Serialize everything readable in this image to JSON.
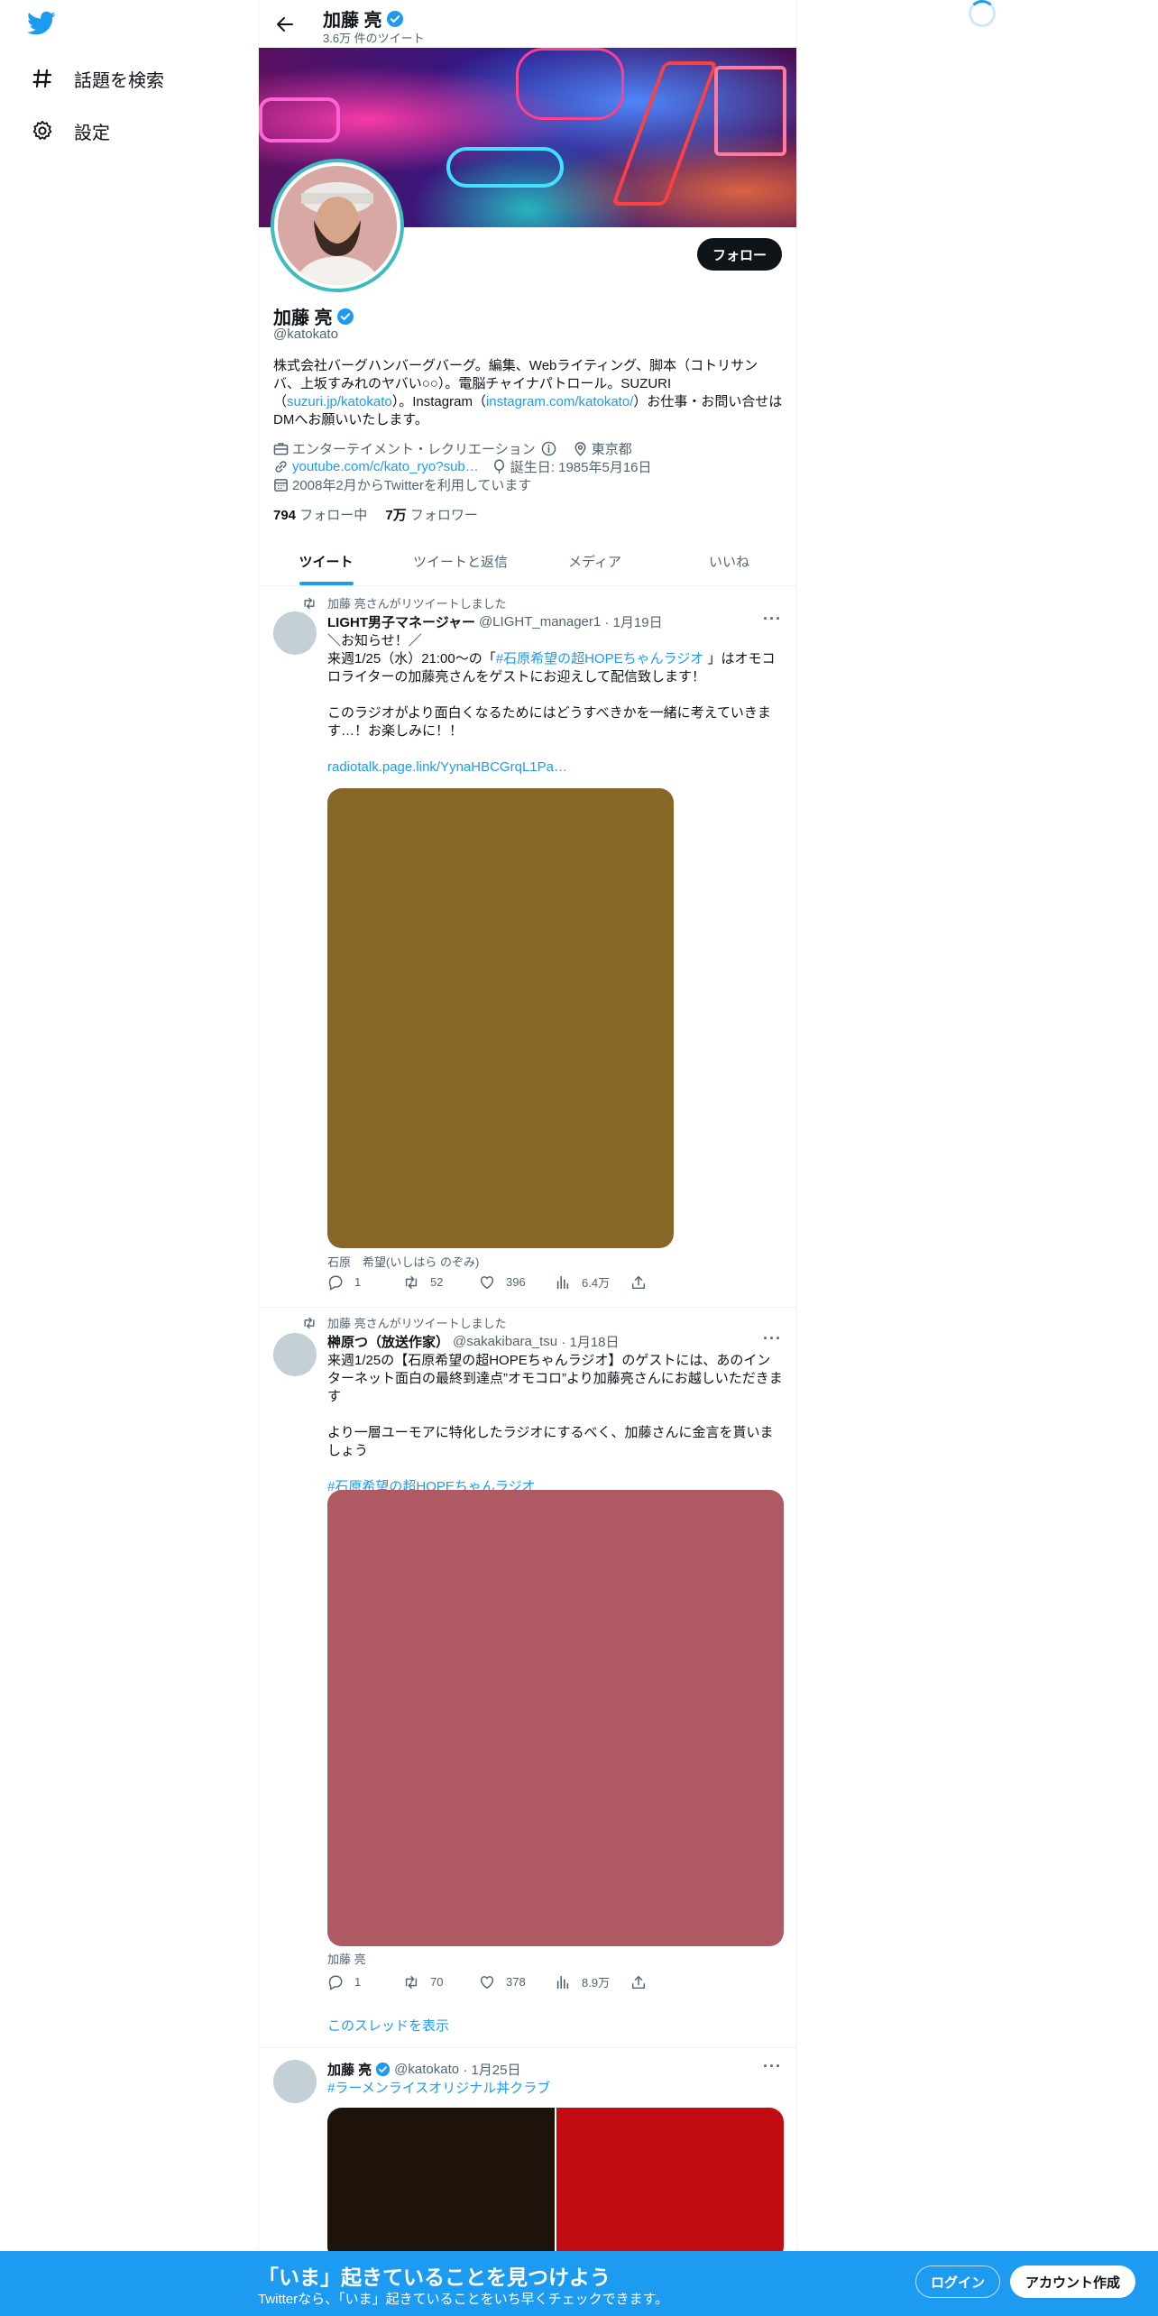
{
  "nav": {
    "explore_label": "話題を検索",
    "settings_label": "設定"
  },
  "header": {
    "name": "加藤 亮",
    "tweet_count": "3.6万 件のツイート"
  },
  "profile": {
    "name": "加藤 亮",
    "handle": "@katokato",
    "follow_label": "フォロー",
    "bio_1": "株式会社バーグハンバーグバーグ。編集、Webライティング、脚本（コトリサンバ、上坂すみれのヤバい○○）。電脳チャイナパトロール。SUZURI（",
    "bio_link1": "suzuri.jp/katokato",
    "bio_2": "）。Instagram（",
    "bio_link2": "instagram.com/katokato/",
    "bio_3": "）お仕事・お問い合せはDMへお願いいたします。",
    "category": "エンターテイメント・レクリエーション",
    "location": "東京都",
    "website": "youtube.com/c/kato_ryo?sub…",
    "birthday": "誕生日: 1985年5月16日",
    "joined": "2008年2月からTwitterを利用しています",
    "following_count": "794",
    "following_label": "フォロー中",
    "followers_count": "7万",
    "followers_label": "フォロワー"
  },
  "tabs": [
    "ツイート",
    "ツイートと返信",
    "メディア",
    "いいね"
  ],
  "tweets": [
    {
      "retweet_label": "加藤 亮さんがリツイートしました",
      "author": "LIGHT男子マネージャー",
      "handle": "@LIGHT_manager1",
      "date": "· 1月19日",
      "line1": "＼お知らせ！／",
      "line2_a": "来週1/25（水）21:00〜の「",
      "line2_tag": "#石原希望の超HOPEちゃんラジオ",
      "line2_b": " 」はオモコロライターの加藤亮さんをゲストにお迎えして配信致します！",
      "line3": "このラジオがより面白くなるためにはどうすべきかを一緒に考えていきます…！お楽しみに！！",
      "link": "radiotalk.page.link/YynaHBCGrqL1Pa…",
      "media_color": "#876627",
      "caption": "石原　希望(いしはら のぞみ)",
      "replies": "1",
      "retweets": "52",
      "likes": "396",
      "views": "6.4万"
    },
    {
      "retweet_label": "加藤 亮さんがリツイートしました",
      "author": "榊原つ（放送作家）",
      "handle": "@sakakibara_tsu",
      "date": "· 1月18日",
      "line1": "来週1/25の【石原希望の超HOPEちゃんラジオ】のゲストには、あのインターネット面白の最終到達点”オモコロ”より加藤亮さんにお越しいただきます",
      "line2": "より一層ユーモアに特化したラジオにするべく、加藤さんに金言を貰いましょう",
      "tag": "#石原希望の超HOPEちゃんラジオ",
      "media_color": "#af5a62",
      "caption": "加藤 亮",
      "replies": "1",
      "retweets": "70",
      "likes": "378",
      "views": "8.9万",
      "thread_label": "このスレッドを表示"
    },
    {
      "author": "加藤 亮",
      "handle": "@katokato",
      "date": "· 1月25日",
      "tag": "#ラーメンライスオリジナル丼クラブ",
      "media_color_left": "#1e140c",
      "media_color_right": "#c20c12"
    }
  ],
  "bottom": {
    "title": "「いま」起きていることを見つけよう",
    "subtitle": "Twitterなら、「いま」起きていることをいち早くチェックできます。",
    "login_label": "ログイン",
    "signup_label": "アカウント作成"
  },
  "colors": {
    "accent": "#1d9bf0",
    "verified": "#1d9bf0",
    "avatar_ring": "#3dbbc1"
  }
}
